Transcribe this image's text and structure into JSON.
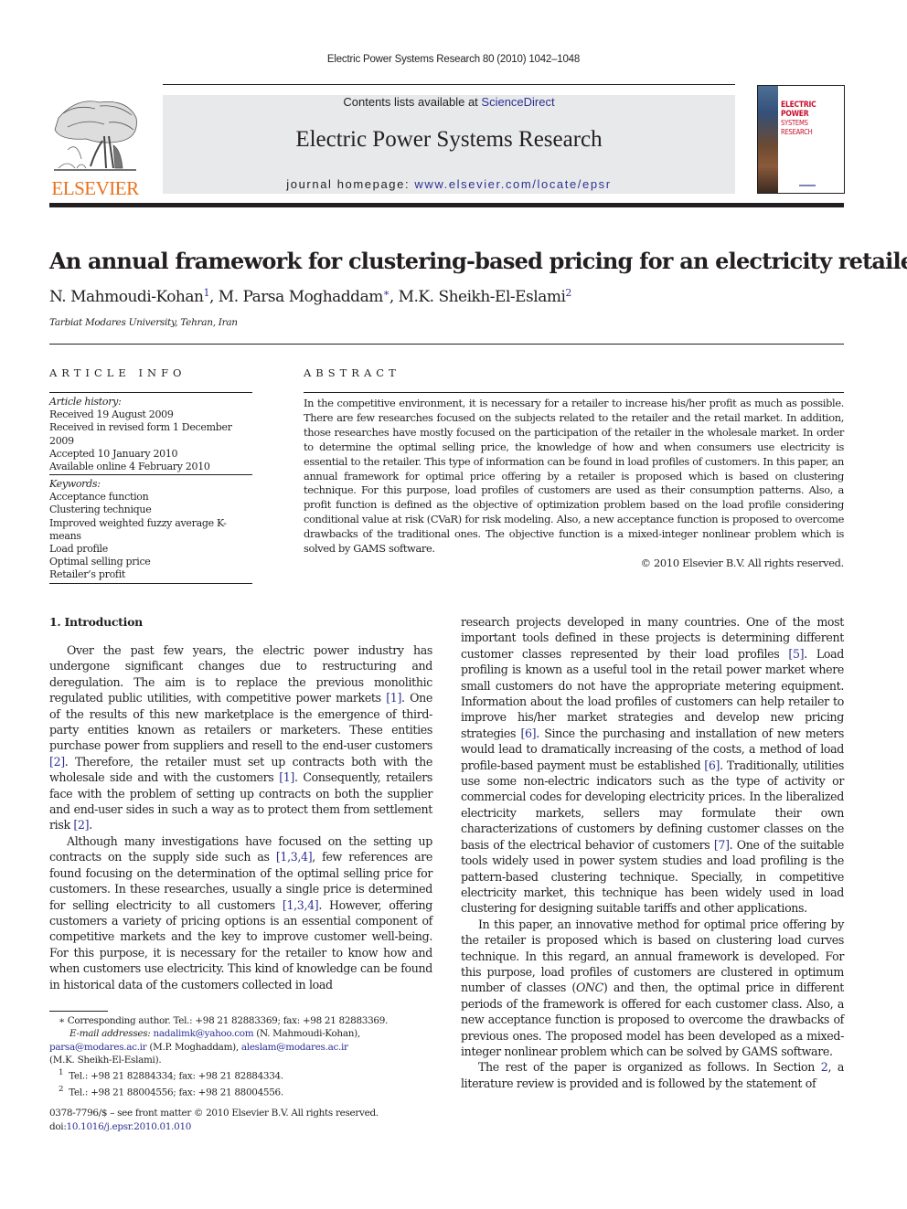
{
  "header": {
    "running_head": "Electric Power Systems Research 80 (2010) 1042–1048",
    "publisher_logo_text": "ELSEVIER",
    "contents_prefix": "Contents lists available at ",
    "contents_link": "ScienceDirect",
    "journal_title": "Electric Power Systems Research",
    "homepage_prefix": "journal homepage: ",
    "homepage_link": "www.elsevier.com/locate/epsr",
    "cover_title_line1": "ELECTRIC POWER",
    "cover_title_line2": "SYSTEMS RESEARCH"
  },
  "article": {
    "title": "An annual framework for clustering-based pricing for an electricity retailer",
    "authors": [
      {
        "name": "N. Mahmoudi-Kohan",
        "mark": "1"
      },
      {
        "name": "M. Parsa Moghaddam",
        "mark": "∗"
      },
      {
        "name": "M.K. Sheikh-El-Eslami",
        "mark": "2"
      }
    ],
    "author_separator": ", ",
    "affiliation": "Tarbiat Modares University, Tehran, Iran"
  },
  "article_info": {
    "label": "ARTICLE INFO",
    "history_heading": "Article history:",
    "history": [
      "Received 19 August 2009",
      "Received in revised form 1 December 2009",
      "Accepted 10 January 2010",
      "Available online 4 February 2010"
    ],
    "keywords_heading": "Keywords:",
    "keywords": [
      "Acceptance function",
      "Clustering technique",
      "Improved weighted fuzzy average K-means",
      "Load profile",
      "Optimal selling price",
      "Retailer’s profit"
    ]
  },
  "abstract": {
    "label": "ABSTRACT",
    "text": "In the competitive environment, it is necessary for a retailer to increase his/her profit as much as possible. There are few researches focused on the subjects related to the retailer and the retail market. In addition, those researches have mostly focused on the participation of the retailer in the wholesale market. In order to determine the optimal selling price, the knowledge of how and when consumers use electricity is essential to the retailer. This type of information can be found in load profiles of customers. In this paper, an annual framework for optimal price offering by a retailer is proposed which is based on clustering technique. For this purpose, load profiles of customers are used as their consumption patterns. Also, a profit function is defined as the objective of optimization problem based on the load profile considering conditional value at risk (CVaR) for risk modeling. Also, a new acceptance function is proposed to overcome drawbacks of the traditional ones. The objective function is a mixed-integer nonlinear problem which is solved by GAMS software.",
    "copyright": "© 2010 Elsevier B.V. All rights reserved."
  },
  "introduction": {
    "heading": "1.  Introduction",
    "left_p1": [
      {
        "t": "Over the past few years, the electric power industry has undergone significant changes due to restructuring and deregulation. The aim is to replace the previous monolithic regulated public utilities, with competitive power markets "
      },
      {
        "ref": "[1]"
      },
      {
        "t": ". One of the results of this new marketplace is the emergence of third-party entities known as retailers or marketers. These entities purchase power from suppliers and resell to the end-user customers "
      },
      {
        "ref": "[2]"
      },
      {
        "t": ". Therefore, the retailer must set up contracts both with the wholesale side and with the customers "
      },
      {
        "ref": "[1]"
      },
      {
        "t": ". Consequently, retailers face with the problem of setting up contracts on both the supplier and end-user sides in such a way as to protect them from settlement risk "
      },
      {
        "ref": "[2]"
      },
      {
        "t": "."
      }
    ],
    "left_p2": [
      {
        "t": "Although many investigations have focused on the setting up contracts on the supply side such as "
      },
      {
        "ref": "[1,3,4]"
      },
      {
        "t": ", few references are found focusing on the determination of the optimal selling price for customers. In these researches, usually a single price is determined for selling electricity to all customers "
      },
      {
        "ref": "[1,3,4]"
      },
      {
        "t": ". However, offering customers a variety of pricing options is an essential component of competitive markets and the key to improve customer well-being. For this purpose, it is necessary for the retailer to know how and when customers use electricity. This kind of knowledge can be found in historical data of the customers collected in load"
      }
    ],
    "right_p1": [
      {
        "t": "research projects developed in many countries. One of the most important tools defined in these projects is determining different customer classes represented by their load profiles "
      },
      {
        "ref": "[5]"
      },
      {
        "t": ". Load profiling is known as a useful tool in the retail power market where small customers do not have the appropriate metering equipment. Information about the load profiles of customers can help retailer to improve his/her market strategies and develop new pricing strategies "
      },
      {
        "ref": "[6]"
      },
      {
        "t": ". Since the purchasing and installation of new meters would lead to dramatically increasing of the costs, a method of load profile-based payment must be established "
      },
      {
        "ref": "[6]"
      },
      {
        "t": ". Traditionally, utilities use some non-electric indicators such as the type of activity or commercial codes for developing electricity prices. In the liberalized electricity markets, sellers may formulate their own characterizations of customers by defining customer classes on the basis of the electrical behavior of customers "
      },
      {
        "ref": "[7]"
      },
      {
        "t": ". One of the suitable tools widely used in power system studies and load profiling is the pattern-based clustering technique. Specially, in competitive electricity market, this technique has been widely used in load clustering for designing suitable tariffs and other applications."
      }
    ],
    "right_p2": [
      {
        "t": "In this paper, an innovative method for optimal price offering by the retailer is proposed which is based on clustering load curves technique. In this regard, an annual framework is developed. For this purpose, load profiles of customers are clustered in optimum number of classes ("
      },
      {
        "em": "ONC"
      },
      {
        "t": ") and then, the optimal price in different periods of the framework is offered for each customer class. Also, a new acceptance function is proposed to overcome the drawbacks of previous ones. The proposed model has been developed as a mixed-integer nonlinear problem which can be solved by GAMS software."
      }
    ],
    "right_p3": [
      {
        "t": "The rest of the paper is organized as follows. In Section "
      },
      {
        "ref": "2"
      },
      {
        "t": ", a literature review is provided and is followed by the statement of"
      }
    ]
  },
  "footnotes": {
    "corresponding": "∗  Corresponding author. Tel.: +98 21 82883369; fax: +98 21 82883369.",
    "email_label": "E-mail addresses: ",
    "email1": "nadalimk@yahoo.com",
    "email1_owner": " (N. Mahmoudi-Kohan),",
    "email2": "parsa@modares.ac.ir",
    "email2_owner": " (M.P. Moghaddam), ",
    "email3": "aleslam@modares.ac.ir",
    "email3_owner": "(M.K. Sheikh-El-Eslami).",
    "fn1_mark": "1",
    "fn1": "Tel.: +98 21 82884334; fax: +98 21 82884334.",
    "fn2_mark": "2",
    "fn2": "Tel.: +98 21 88004556; fax: +98 21 88004556."
  },
  "front_matter": {
    "issn_line": "0378-7796/$ – see front matter © 2010 Elsevier B.V. All rights reserved.",
    "doi_prefix": "doi:",
    "doi": "10.1016/j.epsr.2010.01.010"
  },
  "colors": {
    "link": "#2e3192",
    "elsevier_orange": "#e9711c",
    "banner_bg": "#e8e9ea",
    "cover_red": "#c8102e"
  }
}
